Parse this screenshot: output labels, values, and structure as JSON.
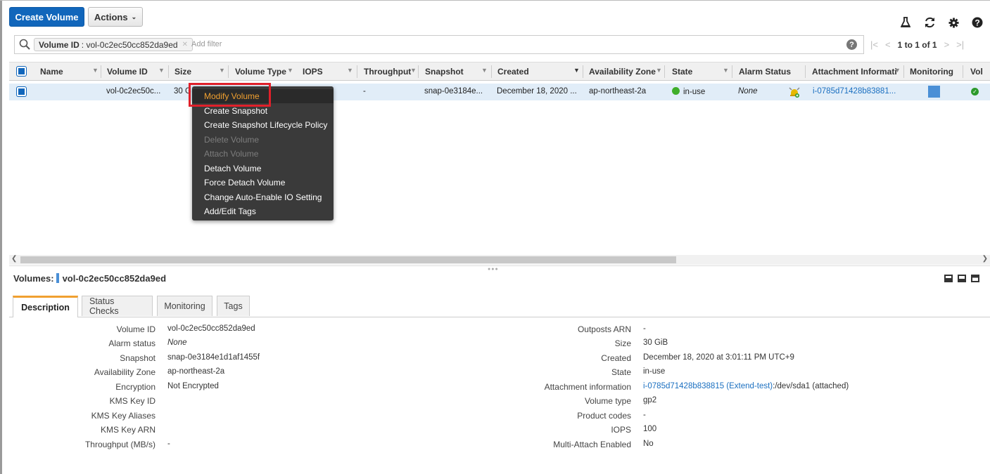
{
  "toolbar": {
    "create_label": "Create Volume",
    "actions_label": "Actions",
    "icon_names": [
      "flask-icon",
      "refresh-icon",
      "gear-icon",
      "help-icon"
    ]
  },
  "filter": {
    "chip_key": "Volume ID",
    "chip_value": ": vol-0c2ec50cc852da9ed",
    "placeholder": "Add filter",
    "help": "?"
  },
  "pager": {
    "first": "|<",
    "prev": "<",
    "range": "1 to 1 of 1",
    "next": ">",
    "last": ">|"
  },
  "table": {
    "headers": {
      "name": "Name",
      "volume_id": "Volume ID",
      "size": "Size",
      "volume_type": "Volume Type",
      "iops": "IOPS",
      "throughput": "Throughput",
      "snapshot": "Snapshot",
      "created": "Created",
      "availability_zone": "Availability Zone",
      "state": "State",
      "alarm_status": "Alarm Status",
      "attachment": "Attachment Informati",
      "monitoring": "Monitoring",
      "volume_status": "Vol"
    },
    "row": {
      "volume_id": "vol-0c2ec50c...",
      "size": "30 G",
      "throughput": "-",
      "snapshot": "snap-0e3184e...",
      "created": "December 18, 2020 ...",
      "availability_zone": "ap-northeast-2a",
      "state": "in-use",
      "alarm_status": "None",
      "attachment": "i-0785d71428b83881..."
    }
  },
  "context_menu": {
    "items": [
      {
        "label": "Modify Volume",
        "state": "highlighted"
      },
      {
        "label": "Create Snapshot",
        "state": "enabled"
      },
      {
        "label": "Create Snapshot Lifecycle Policy",
        "state": "enabled"
      },
      {
        "label": "Delete Volume",
        "state": "disabled"
      },
      {
        "label": "Attach Volume",
        "state": "disabled"
      },
      {
        "label": "Detach Volume",
        "state": "enabled"
      },
      {
        "label": "Force Detach Volume",
        "state": "enabled"
      },
      {
        "label": "Change Auto-Enable IO Setting",
        "state": "enabled"
      },
      {
        "label": "Add/Edit Tags",
        "state": "enabled"
      }
    ]
  },
  "details": {
    "title_prefix": "Volumes:",
    "title_value": "vol-0c2ec50cc852da9ed",
    "tabs": [
      "Description",
      "Status Checks",
      "Monitoring",
      "Tags"
    ],
    "left": [
      {
        "label": "Volume ID",
        "value": "vol-0c2ec50cc852da9ed"
      },
      {
        "label": "Alarm status",
        "value": "None"
      },
      {
        "label": "Snapshot",
        "value": "snap-0e3184e1d1af1455f"
      },
      {
        "label": "Availability Zone",
        "value": "ap-northeast-2a"
      },
      {
        "label": "Encryption",
        "value": "Not Encrypted"
      },
      {
        "label": "KMS Key ID",
        "value": ""
      },
      {
        "label": "KMS Key Aliases",
        "value": ""
      },
      {
        "label": "KMS Key ARN",
        "value": ""
      },
      {
        "label": "Throughput (MB/s)",
        "value": "-"
      }
    ],
    "right": [
      {
        "label": "Outposts ARN",
        "value": "-"
      },
      {
        "label": "Size",
        "value": "30 GiB"
      },
      {
        "label": "Created",
        "value": "December 18, 2020 at 3:01:11 PM UTC+9"
      },
      {
        "label": "State",
        "value": "in-use"
      },
      {
        "label": "Attachment information",
        "value_link": "i-0785d71428b838815 (Extend-test)",
        "value_rest": ":/dev/sda1 (attached)"
      },
      {
        "label": "Volume type",
        "value": "gp2"
      },
      {
        "label": "Product codes",
        "value": "-"
      },
      {
        "label": "IOPS",
        "value": "100"
      },
      {
        "label": "Multi-Attach Enabled",
        "value": "No"
      }
    ]
  },
  "colors": {
    "primary": "#1166bb",
    "menu_highlight": "#f0a030",
    "red_outline": "#e0202a",
    "selected_row": "#e1edf8"
  }
}
